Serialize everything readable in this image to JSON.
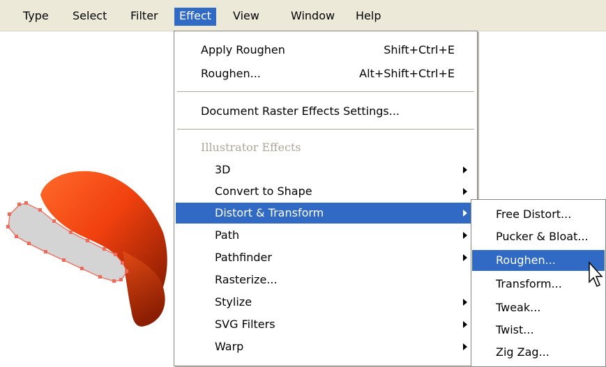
{
  "menubar": {
    "items": [
      {
        "label": "Type"
      },
      {
        "label": "Select"
      },
      {
        "label": "Filter"
      },
      {
        "label": "Effect"
      },
      {
        "label": "View"
      },
      {
        "label": "Window"
      },
      {
        "label": "Help"
      }
    ]
  },
  "effect_menu": {
    "apply_roughen": {
      "label": "Apply Roughen",
      "shortcut": "Shift+Ctrl+E"
    },
    "roughen": {
      "label": "Roughen...",
      "shortcut": "Alt+Shift+Ctrl+E"
    },
    "document_raster": {
      "label": "Document Raster Effects Settings..."
    },
    "section_header": "Illustrator Effects",
    "items": [
      {
        "label": "3D"
      },
      {
        "label": "Convert to Shape"
      },
      {
        "label": "Distort & Transform"
      },
      {
        "label": "Path"
      },
      {
        "label": "Pathfinder"
      },
      {
        "label": "Rasterize..."
      },
      {
        "label": "Stylize"
      },
      {
        "label": "SVG Filters"
      },
      {
        "label": "Warp"
      }
    ]
  },
  "submenu": {
    "items": [
      {
        "label": "Free Distort..."
      },
      {
        "label": "Pucker & Bloat..."
      },
      {
        "label": "Roughen..."
      },
      {
        "label": "Transform..."
      },
      {
        "label": "Tweak..."
      },
      {
        "label": "Twist..."
      },
      {
        "label": "Zig Zag..."
      }
    ]
  },
  "colors": {
    "highlight": "#316ac5",
    "menubar_bg": "#ece9d8",
    "hat_orange": "#ff5a1f",
    "hat_dark": "#8a1a00",
    "brim_gray": "#d4d4d4",
    "selection_red": "#f06a5a"
  }
}
